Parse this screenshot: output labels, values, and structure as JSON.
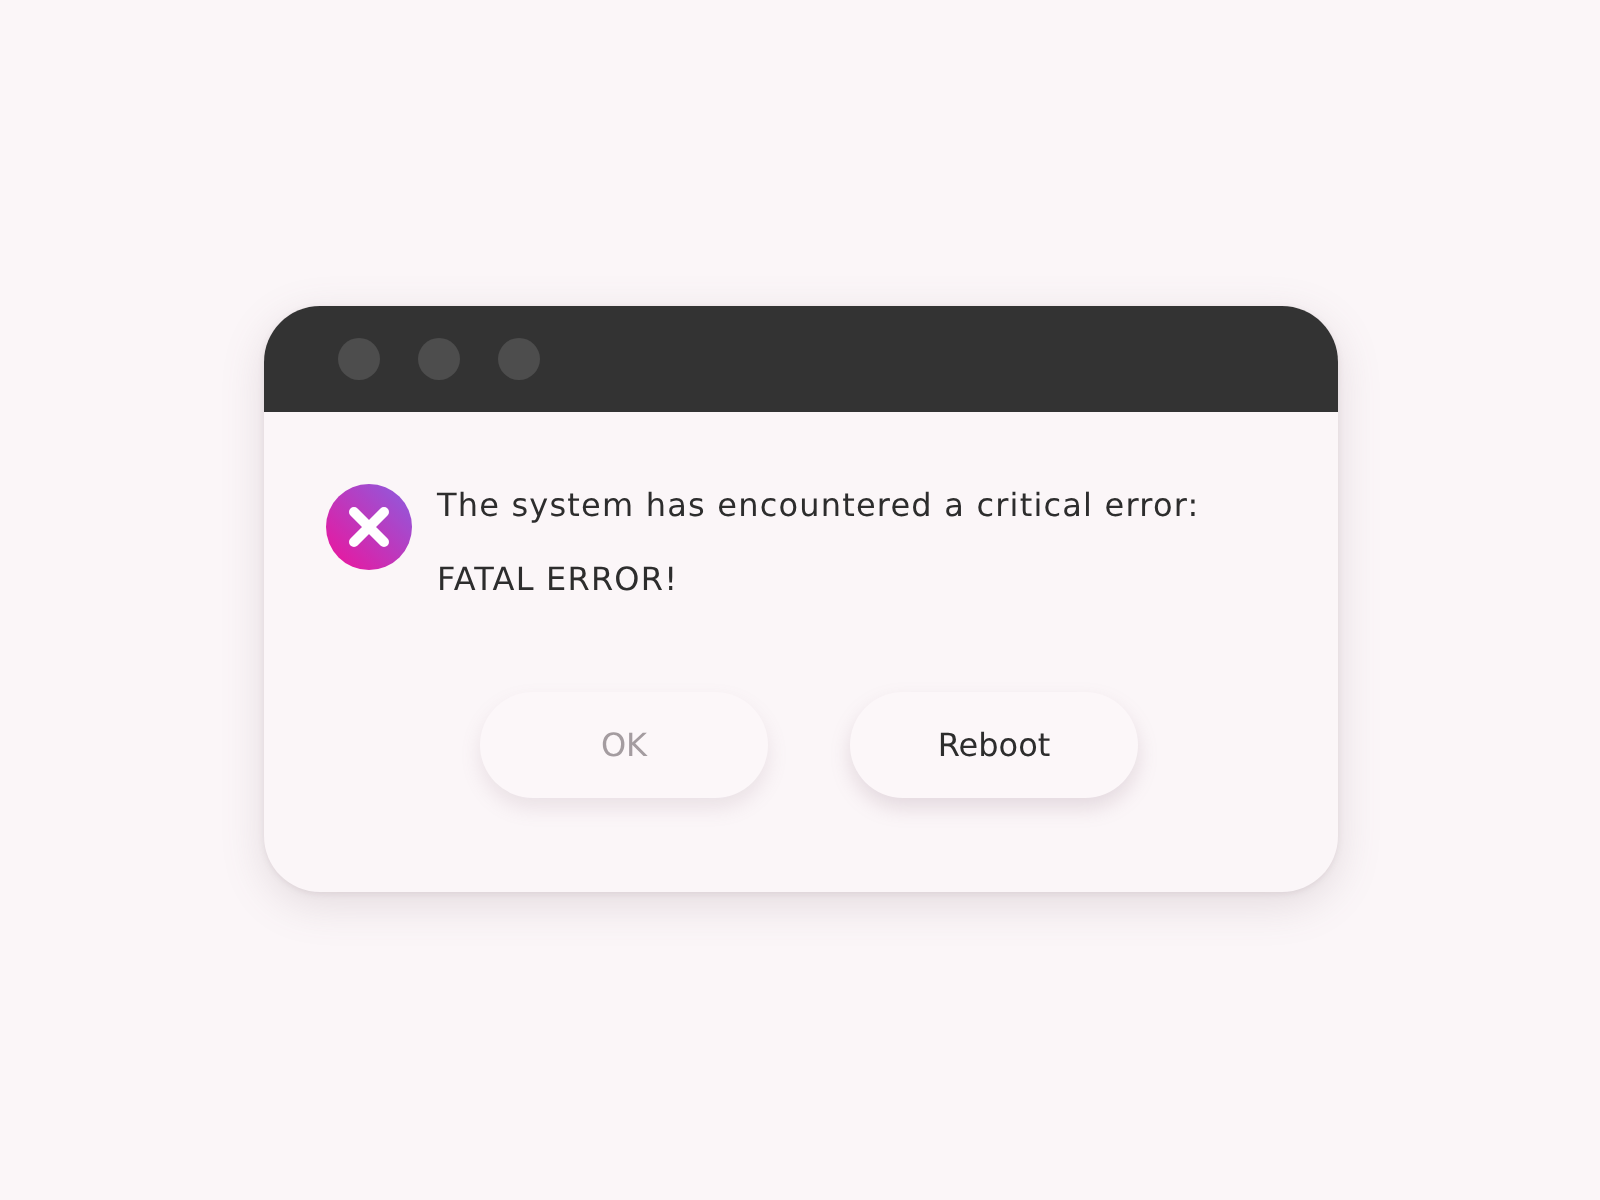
{
  "dialog": {
    "message": "The system has encountered a critical error:",
    "detail": "FATAL ERROR!",
    "buttons": [
      {
        "label": "OK",
        "disabled": true
      },
      {
        "label": "Reboot",
        "disabled": false
      }
    ]
  }
}
